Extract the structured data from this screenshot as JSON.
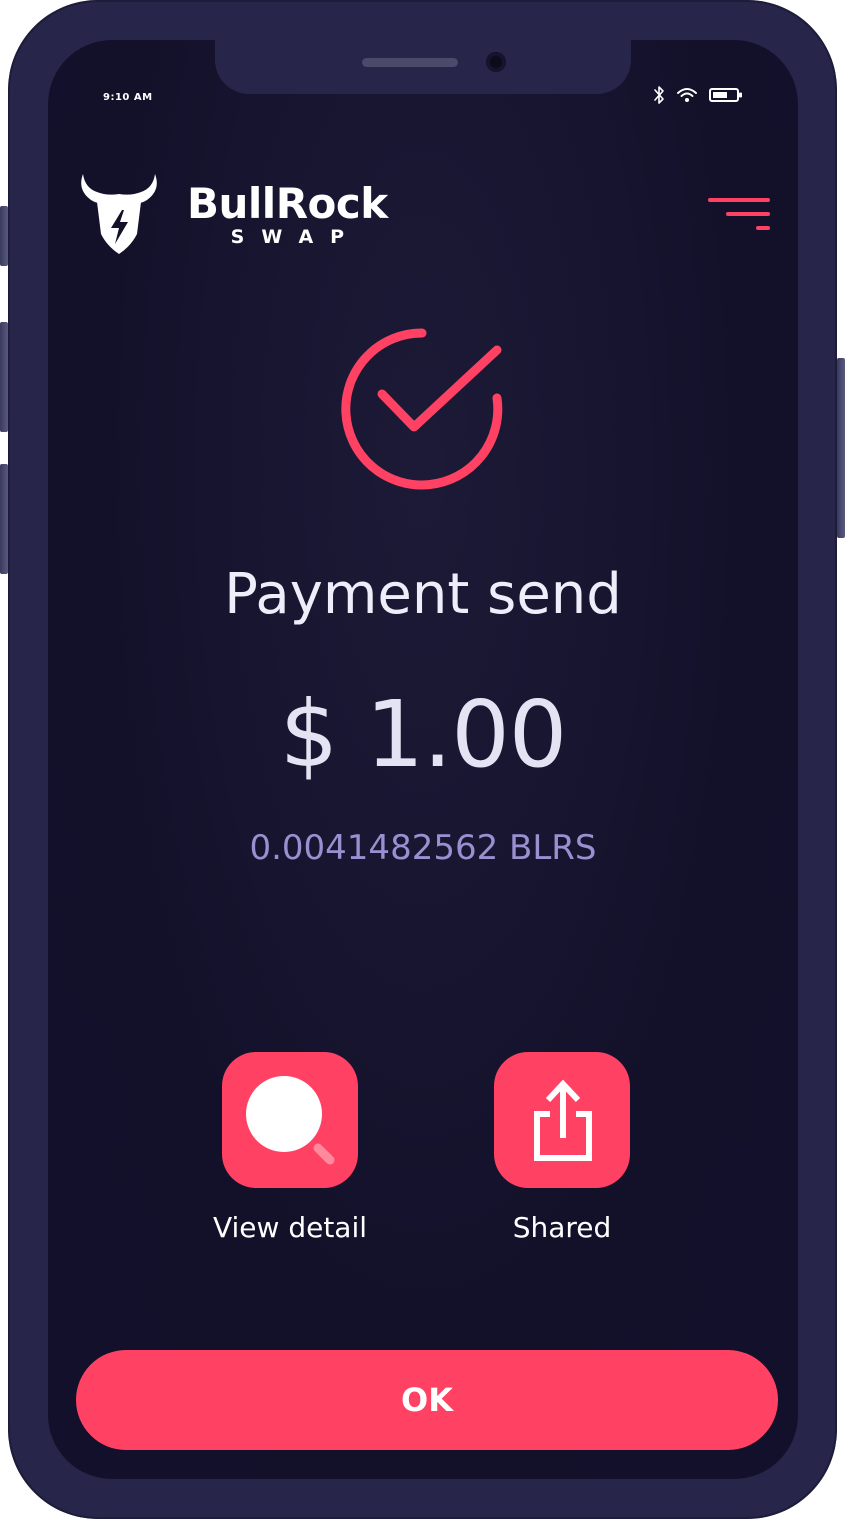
{
  "status_bar": {
    "time": "9:10 AM",
    "icons": [
      "bluetooth-icon",
      "wifi-icon",
      "battery-icon"
    ]
  },
  "header": {
    "brand_name": "BullRock",
    "brand_sub": "SWAP",
    "logo_icon": "bull-head-bolt-icon",
    "menu_icon": "menu-icon"
  },
  "status_icon": "check-circle-icon",
  "title": "Payment send",
  "amount": "$ 1.00",
  "crypto_amount": "0.0041482562 BLRS",
  "actions": [
    {
      "label": "View detail",
      "icon": "search-icon"
    },
    {
      "label": "Shared",
      "icon": "share-icon"
    }
  ],
  "ok_label": "OK",
  "colors": {
    "accent": "#ff4263",
    "background": "#13112a",
    "frame": "#27264a",
    "crypto_text": "#9a8fd0"
  }
}
